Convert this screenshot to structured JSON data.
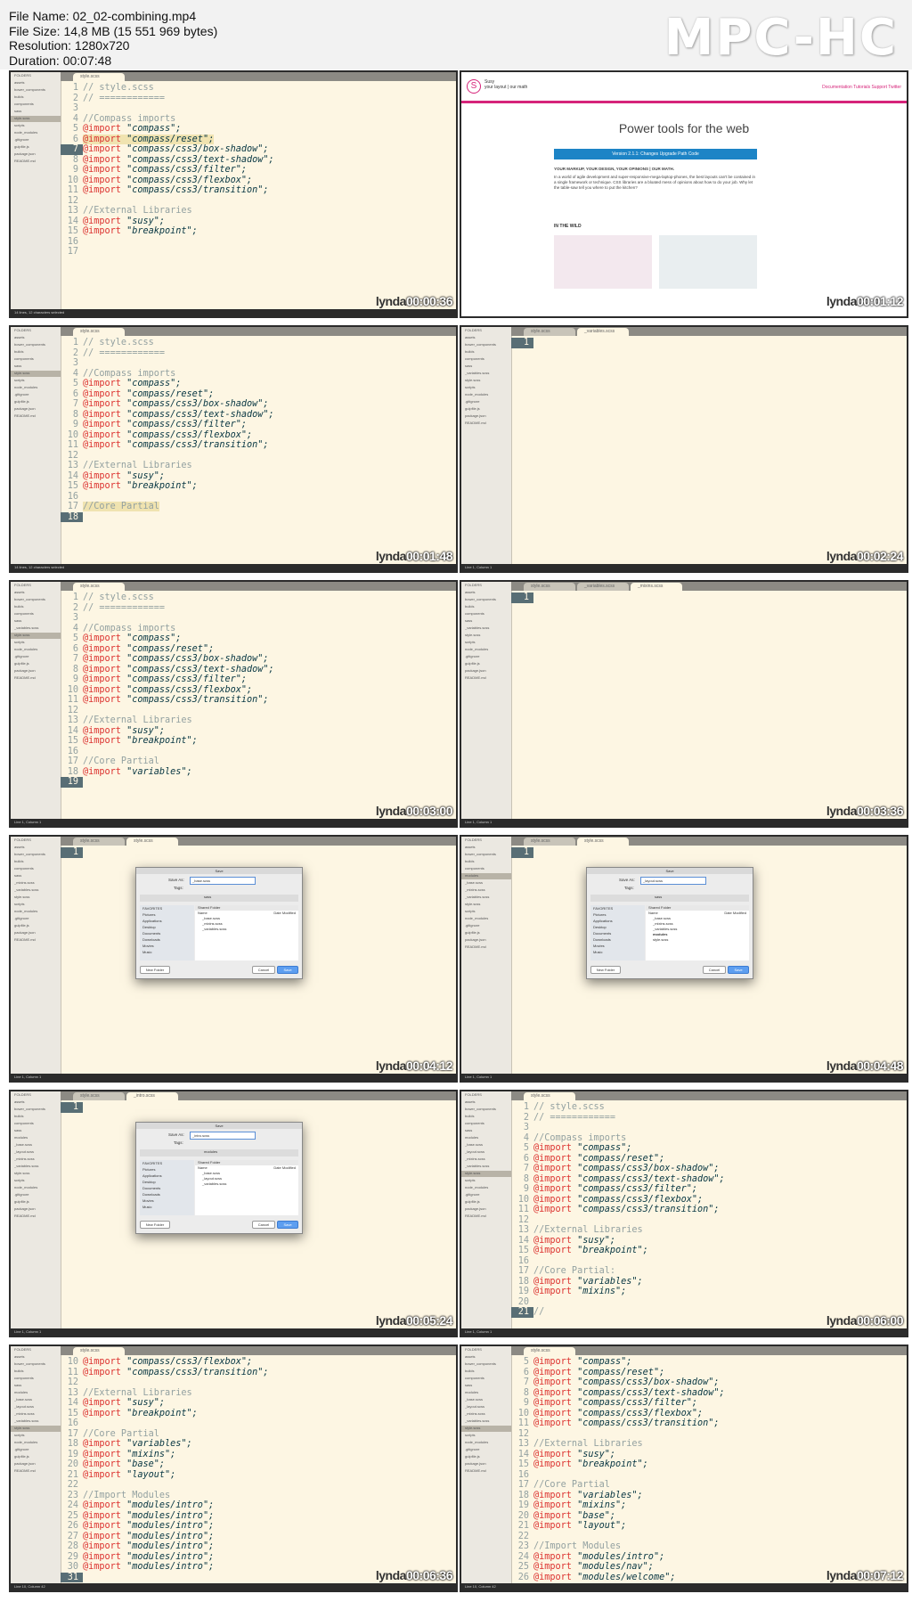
{
  "header": {
    "file_name": "File Name: 02_02-combining.mp4",
    "file_size": "File Size: 14,8 MB (15 551 969 bytes)",
    "resolution": "Resolution: 1280x720",
    "duration": "Duration: 00:07:48",
    "logo": "MPC-HC"
  },
  "watermark": "lynda",
  "timestamps": [
    "00:00:36",
    "00:01:12",
    "00:01:48",
    "00:02:24",
    "00:03:00",
    "00:03:36",
    "00:04:12",
    "00:04:48",
    "00:05:24",
    "00:06:00",
    "00:06:36",
    "00:07:12"
  ],
  "tabs": {
    "style": "style.scss",
    "variables": "_variables.scss",
    "mixins": "_mixins.scss",
    "intro": "_intro.scss"
  },
  "web": {
    "brand": "Susy",
    "tagline": "your layout | our math",
    "nav": "Documentation  Tutorials  Support  Twitter",
    "title": "Power tools for the web",
    "version_bar": "Version 2.1.1:  Changes  Upgrade Path  Code",
    "heading": "YOUR MARKUP, YOUR DESIGN, YOUR OPINIONS | OUR MATH.",
    "body": "In a world of agile development and super-responsive-mega-laptop-phones, the best layouts can't be contained in a single framework or technique. CSS libraries are a bloated mess of opinions about how to do your job. Why let the table-saw tell you where to put the kitchen?",
    "in_the_wild": "IN THE WILD"
  },
  "dialog": {
    "title": "Save",
    "save_as_label": "Save As:",
    "tags_label": "Tags:",
    "folder": "sass",
    "folder_modules": "modules",
    "favorites": [
      "FAVORITES",
      "Pictures",
      "Applications",
      "Desktop",
      "Documents",
      "Downloads",
      "Movies",
      "Music"
    ],
    "column_name": "Name",
    "column_date": "Date Modified",
    "shared_folder": "Shared Folder",
    "files": [
      "_base.scss",
      "_mixins.scss",
      "_variables.scss",
      "style.scss"
    ],
    "files_modules": [
      "_base.scss",
      "_mixins.scss",
      "_variables.scss",
      "modules",
      "style.scss"
    ],
    "files_intro": [
      "_base.scss",
      "_layout.scss",
      "_variables.scss"
    ],
    "new_folder": "New Folder",
    "cancel": "Cancel",
    "save": "Save",
    "name_base": "_base.scss",
    "name_layout": "_layout.scss",
    "name_intro": "_intro.scss"
  },
  "sidebar": {
    "folders": "FOLDERS",
    "items": [
      "FOLDERS",
      "assets",
      "bower_components",
      "builds",
      "components",
      "sass",
      "modules",
      "_base.scss",
      "_layout.scss",
      "_mixins.scss",
      "_variables.scss",
      "style.scss",
      "scripts",
      "node_modules",
      ".gitignore",
      "gulpfile.js",
      "package.json",
      "README.md"
    ]
  },
  "statusbar": {
    "a": "Line 1, Column 1",
    "b": "Line 10, Column 42",
    "c": "14 lines, 12 characters selected"
  },
  "code": {
    "l1": "// style.scss",
    "l2": "// ============",
    "compass_comment": "//Compass imports",
    "external_comment": "//External Libraries",
    "core_comment": "//Core Partial",
    "core_comment_colon": "//Core Partial:",
    "modules_comment": "//Import Modules",
    "import_kw": "@import",
    "compass": "\"compass\";",
    "reset": "\"compass/reset\";",
    "box_shadow": "\"compass/css3/box-shadow\";",
    "text_shadow": "\"compass/css3/text-shadow\";",
    "filter": "\"compass/css3/filter\";",
    "flexbox": "\"compass/css3/flexbox\";",
    "transition": "\"compass/css3/transition\";",
    "susy": "\"susy\";",
    "breakpoint": "\"breakpoint\";",
    "variables": "\"variables\";",
    "mixins": "\"mixins\";",
    "base": "\"base\";",
    "layout": "\"layout\";",
    "intro": "\"modules/intro\";",
    "nav": "\"modules/nav\";",
    "welcome": "\"modules/welcome\";",
    "slashes": "//"
  }
}
